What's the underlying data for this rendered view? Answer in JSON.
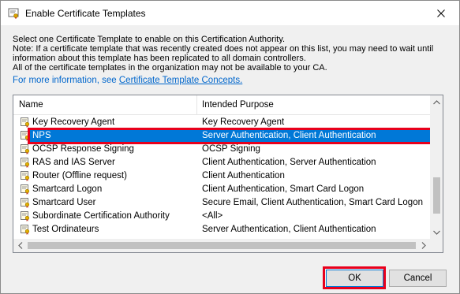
{
  "window": {
    "title": "Enable Certificate Templates",
    "close_glyph": "✕"
  },
  "description": {
    "line1": "Select one Certificate Template to enable on this Certification Authority.",
    "line2": "Note: If a certificate template that was recently created does not appear on this list, you may need to wait until",
    "line3": "information about this template has been replicated to all domain controllers.",
    "line4": "All of the certificate templates in the organization may not be available to your CA.",
    "more_info_prefix": "For more information, see",
    "more_info_link": "Certificate Template Concepts."
  },
  "list": {
    "columns": [
      "Name",
      "Intended Purpose"
    ],
    "rows": [
      {
        "name": "Key Recovery Agent",
        "purpose": "Key Recovery Agent",
        "selected": false
      },
      {
        "name": "NPS",
        "purpose": "Server Authentication, Client Authentication",
        "selected": true
      },
      {
        "name": "OCSP Response Signing",
        "purpose": "OCSP Signing",
        "selected": false
      },
      {
        "name": "RAS and IAS Server",
        "purpose": "Client Authentication, Server Authentication",
        "selected": false
      },
      {
        "name": "Router (Offline request)",
        "purpose": "Client Authentication",
        "selected": false
      },
      {
        "name": "Smartcard Logon",
        "purpose": "Client Authentication, Smart Card Logon",
        "selected": false
      },
      {
        "name": "Smartcard User",
        "purpose": "Secure Email, Client Authentication, Smart Card Logon",
        "selected": false
      },
      {
        "name": "Subordinate Certification Authority",
        "purpose": "<All>",
        "selected": false
      },
      {
        "name": "Test Ordinateurs",
        "purpose": "Server Authentication, Client Authentication",
        "selected": false
      }
    ],
    "row_icon": "certificate-template-icon",
    "selection_color": "#0078d7"
  },
  "buttons": {
    "ok_label": "OK",
    "cancel_label": "Cancel"
  },
  "annotation_color": "#e8001c"
}
